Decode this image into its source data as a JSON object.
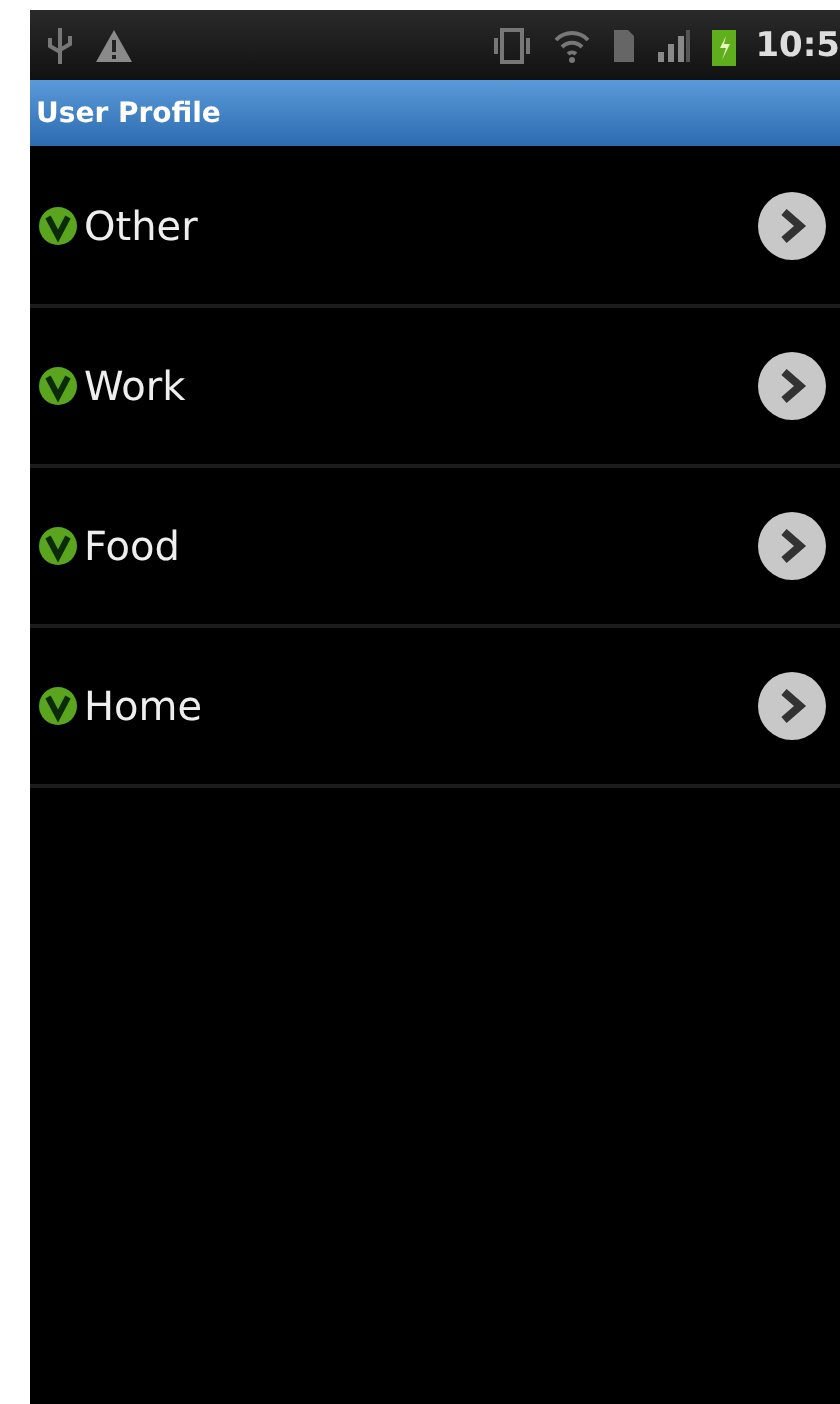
{
  "status_bar": {
    "time": "10:5"
  },
  "title_bar": {
    "title": "User Profile"
  },
  "list": {
    "items": [
      {
        "label": "Other"
      },
      {
        "label": "Work"
      },
      {
        "label": "Food"
      },
      {
        "label": "Home"
      }
    ]
  }
}
